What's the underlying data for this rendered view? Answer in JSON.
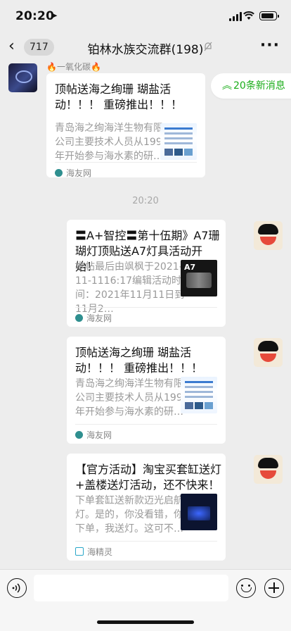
{
  "status": {
    "time": "20:20",
    "location_arrow": "➤"
  },
  "nav": {
    "back_glyph": "‹",
    "unread_count": "717",
    "title": "铂林水族交流群(198)",
    "more_glyph": "···"
  },
  "new_messages": {
    "arrow": "︽",
    "label": "20条新消息"
  },
  "messages": [
    {
      "sender": "🔥一氧化碳🔥",
      "title": "顶帖送海之绚珊 瑚盐活动！！！ 重磅推出！！！",
      "desc": "青岛海之绚海洋生物有限公司主要技术人员从1996年开始参与海水素的研…",
      "source": "海友网",
      "thumb": "doc-icon"
    },
    {
      "time": "20:20"
    },
    {
      "title": "〓A+智控〓第十伍期》A7珊瑚灯顶贴送A7灯具活动开始！",
      "desc": "本帖最后由飒枫于2021-11-1116:17编辑活动时间：2021年11月11日到11月2…",
      "source": "海友网",
      "thumb_label": "A7"
    },
    {
      "title": "顶帖送海之绚珊 瑚盐活动！！！ 重磅推出！！！",
      "desc": "青岛海之绚海洋生物有限公司主要技术人员从1996年开始参与海水素的研…",
      "source": "海友网"
    },
    {
      "title": "【官方活动】淘宝买套缸送灯+盖楼送灯活动，还不快来！",
      "desc": "下单套缸送新款迈光启航灯。是的，你没看错，你下单，我送灯。这可不…",
      "source": "海精灵"
    }
  ],
  "colors": {
    "accent": "#1aad19",
    "background": "#ededed"
  }
}
